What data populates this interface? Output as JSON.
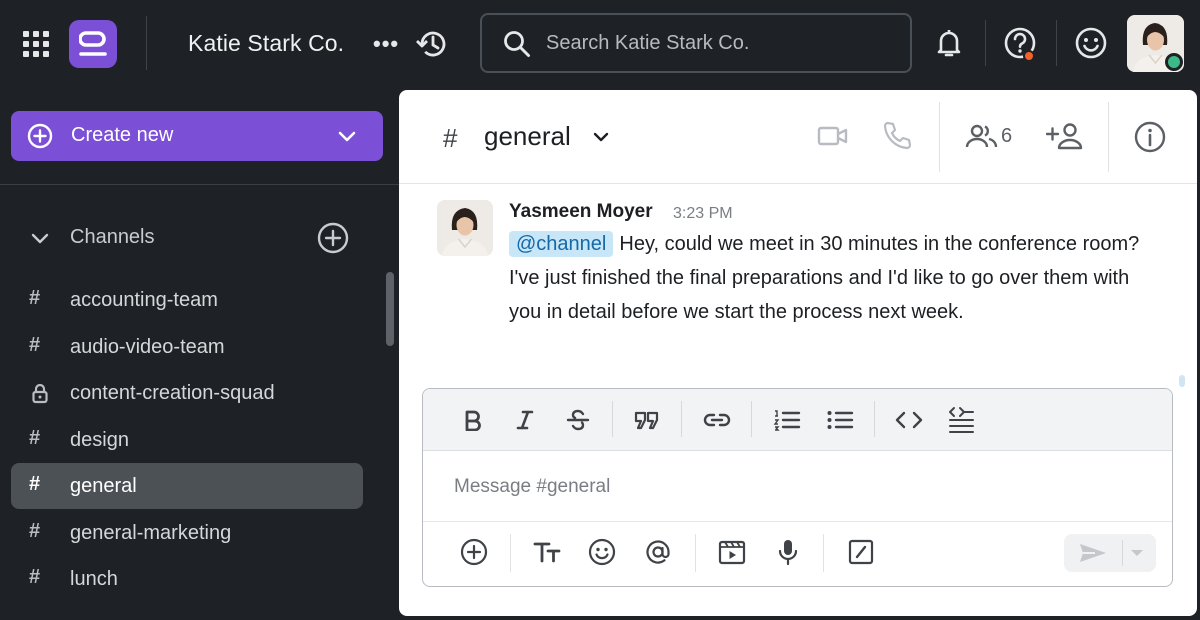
{
  "topbar": {
    "team_name": "Katie Stark Co.",
    "more_label": "•••",
    "search_placeholder": "Search Katie Stark Co."
  },
  "sidebar": {
    "create_label": "Create new",
    "channels_heading": "Channels",
    "channels": [
      {
        "name": "accounting-team",
        "icon": "hash-icon"
      },
      {
        "name": "audio-video-team",
        "icon": "hash-icon"
      },
      {
        "name": "content-creation-squad",
        "icon": "lock-icon"
      },
      {
        "name": "design",
        "icon": "hash-icon"
      },
      {
        "name": "general",
        "icon": "hash-icon",
        "active": true
      },
      {
        "name": "general-marketing",
        "icon": "hash-icon"
      },
      {
        "name": "lunch",
        "icon": "hash-icon"
      }
    ]
  },
  "channel": {
    "hash": "#",
    "name": "general",
    "member_count": "6"
  },
  "message": {
    "author": "Yasmeen Moyer",
    "time": "3:23 PM",
    "mention": "@channel",
    "text": "Hey, could we meet in 30 minutes in the conference room? I've just finished the final preparations and I'd like to go over them with you in detail before we start the process next week."
  },
  "composer": {
    "placeholder": "Message #general"
  },
  "colors": {
    "brand": "#7b4fd6",
    "sidebar_bg": "#1e2226",
    "mention_bg": "#c7e6f7",
    "online": "#3db887",
    "alert": "#f4622a"
  }
}
